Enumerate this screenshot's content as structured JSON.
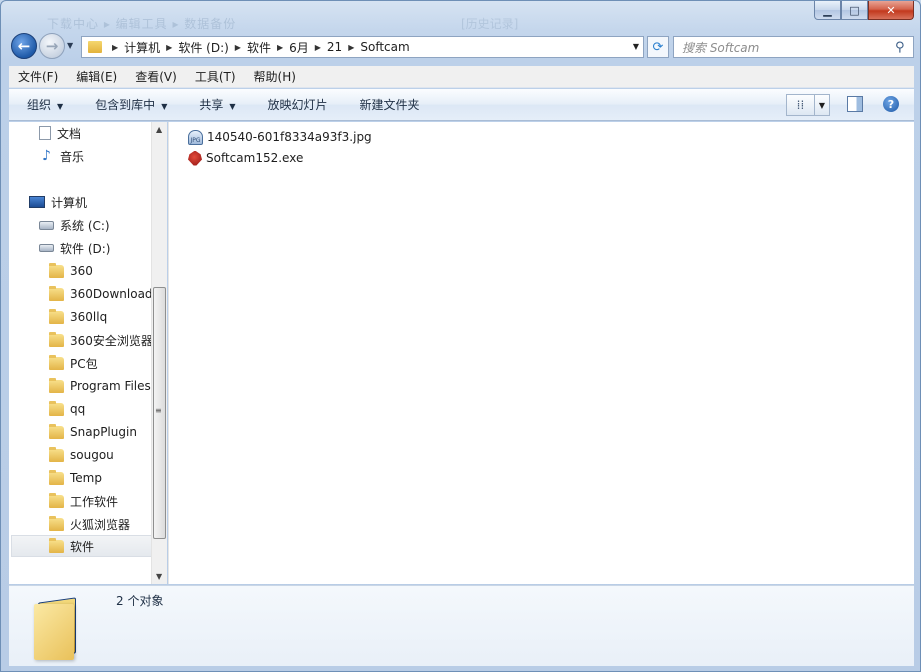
{
  "window": {
    "title_ghost": "下载中心 ▸ 编辑工具 ▸ 数据备份",
    "title_ghost_right": "[历史记录]",
    "controls": {
      "minimize": "▁",
      "maximize": "□",
      "close": "✕"
    }
  },
  "nav": {
    "back_icon": "arrow-left-icon",
    "forward_icon": "arrow-right-icon",
    "breadcrumb": [
      "计算机",
      "软件 (D:)",
      "软件",
      "6月",
      "21",
      "Softcam"
    ],
    "search_placeholder": "搜索 Softcam"
  },
  "menubar": [
    "文件(F)",
    "编辑(E)",
    "查看(V)",
    "工具(T)",
    "帮助(H)"
  ],
  "commandbar": {
    "organize": "组织",
    "include_library": "包含到库中",
    "share": "共享",
    "slideshow": "放映幻灯片",
    "new_folder": "新建文件夹"
  },
  "tree": {
    "documents": "文档",
    "music": "音乐",
    "computer": "计算机",
    "drive_c": "系统 (C:)",
    "drive_d": "软件 (D:)",
    "folders": [
      "360",
      "360Download",
      "360llq",
      "360安全浏览器",
      "PC包",
      "Program Files",
      "qq",
      "SnapPlugin",
      "sougou",
      "Temp",
      "工作软件",
      "火狐浏览器",
      "软件"
    ]
  },
  "files": [
    {
      "name": "140540-601f8334a93f3.jpg",
      "icon": "image-file-icon"
    },
    {
      "name": "Softcam152.exe",
      "icon": "exe-file-icon"
    }
  ],
  "details": {
    "count": "2 个对象"
  },
  "colors": {
    "accent": "#1f5aa8",
    "chrome": "#c4d6ec",
    "close": "#c2391d"
  }
}
